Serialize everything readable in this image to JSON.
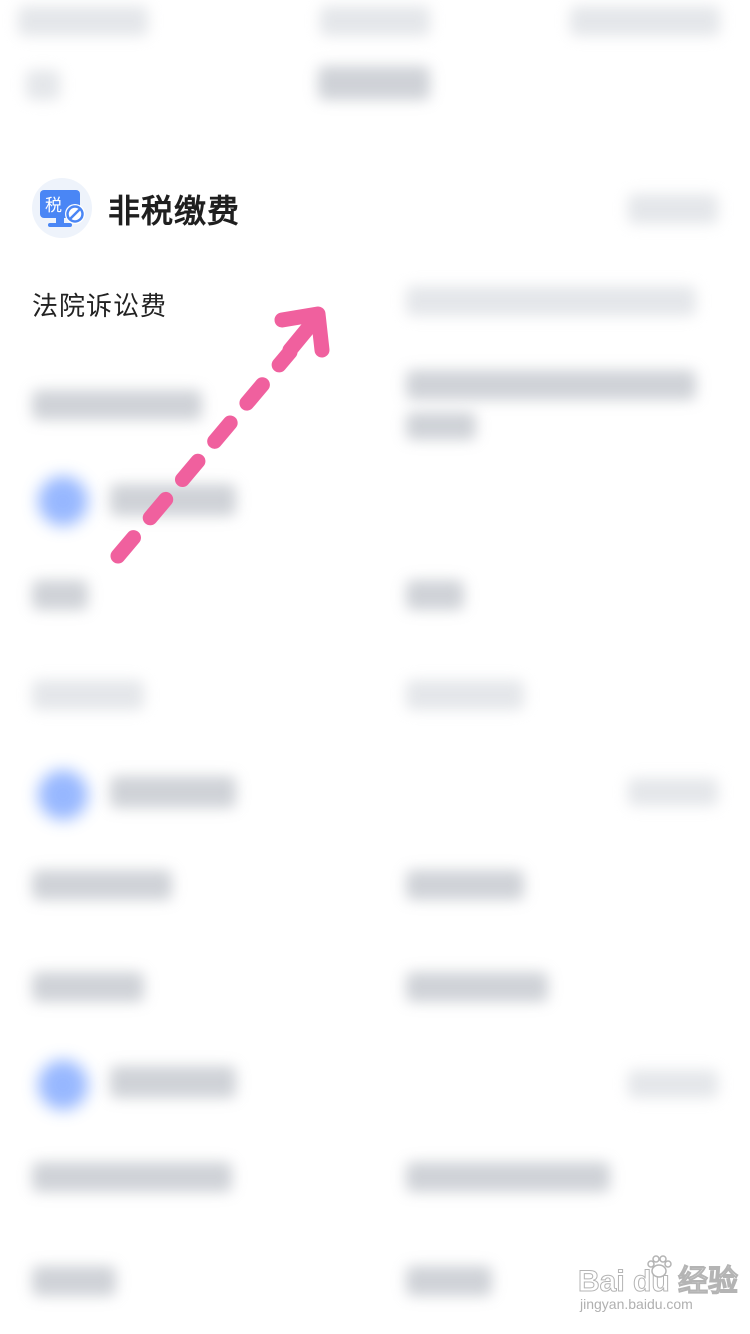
{
  "section": {
    "icon_text": "税",
    "title": "非税缴费",
    "item_label": "法院诉讼费"
  },
  "watermark": {
    "main": "Bai du 经验",
    "sub": "jingyan.baidu.com"
  },
  "colors": {
    "accent_pink": "#f0609e",
    "icon_blue": "#4a86f5",
    "title_text": "#1f1f1f"
  },
  "icons": [
    "tax-monitor-icon",
    "arrow-annotation-icon",
    "baidu-paw-icon"
  ]
}
